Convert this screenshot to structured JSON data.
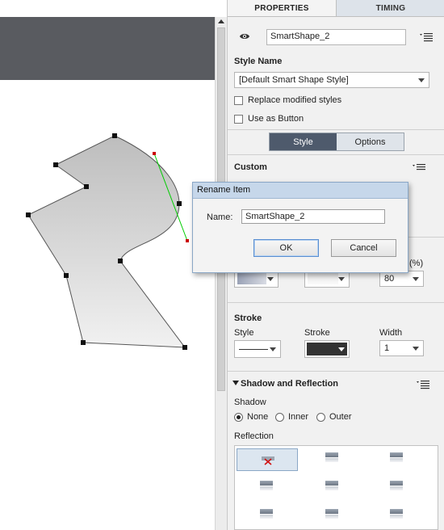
{
  "tabs": [
    {
      "label": "PROPERTIES",
      "active": true
    },
    {
      "label": "TIMING",
      "active": false
    }
  ],
  "object": {
    "name_value": "SmartShape_2",
    "visibility_icon": "eye-icon",
    "menu_icon": "panel-menu-icon"
  },
  "style_name": {
    "label": "Style Name",
    "value": "[Default Smart Shape Style]",
    "replace_label": "Replace modified styles",
    "replace_checked": false,
    "button_label": "Use as Button",
    "button_checked": false
  },
  "segmented": {
    "options": [
      "Style",
      "Options"
    ],
    "selected": "Style"
  },
  "custom": {
    "label": "Custom",
    "partial_label": "(%)",
    "alpha_value": "80"
  },
  "stroke": {
    "section_label": "Stroke",
    "style_label": "Style",
    "stroke_label": "Stroke",
    "width_label": "Width",
    "width_value": "1",
    "stroke_color": "#333333"
  },
  "shadow": {
    "section_label": "Shadow and Reflection",
    "shadow_label": "Shadow",
    "options": [
      "None",
      "Inner",
      "Outer"
    ],
    "selected": "None",
    "reflection_label": "Reflection"
  },
  "dialog": {
    "title": "Rename Item",
    "name_label": "Name:",
    "name_value": "SmartShape_2",
    "ok_label": "OK",
    "cancel_label": "Cancel"
  },
  "colors": {
    "stage_dark": "#595b60",
    "selected_seg": "#4e5a6c",
    "handle_line": "#00cc00",
    "handle_point": "#cc0000"
  }
}
